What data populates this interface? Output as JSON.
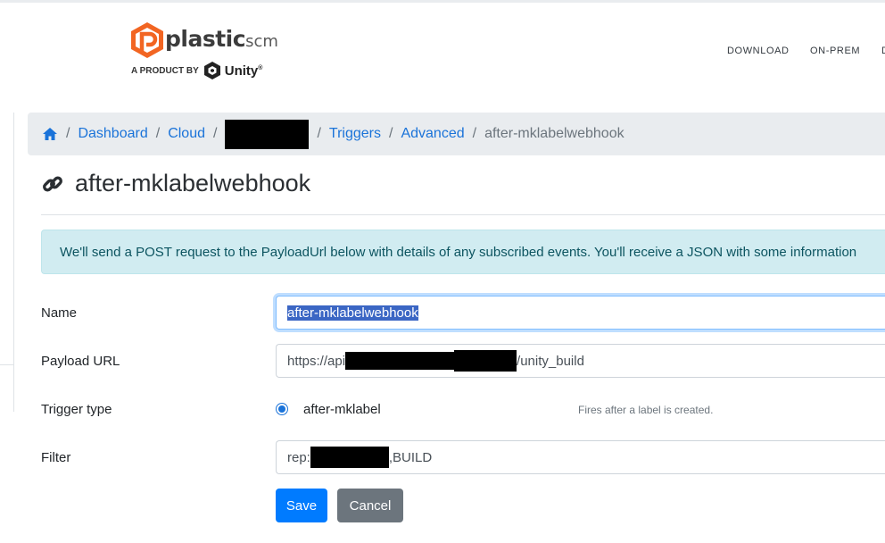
{
  "brand": {
    "word_main": "plastic",
    "word_suffix": "scm",
    "byline": "A PRODUCT BY",
    "unity": "Unity",
    "unity_mark": "®"
  },
  "nav": {
    "download": "DOWNLOAD",
    "onprem": "ON-PREM",
    "cut": "D"
  },
  "breadcrumb": {
    "dashboard": "Dashboard",
    "cloud": "Cloud",
    "triggers": "Triggers",
    "advanced": "Advanced",
    "current": "after-mklabelwebhook",
    "separator": "/"
  },
  "page": {
    "title": "after-mklabelwebhook"
  },
  "alert": {
    "text": "We'll send a POST request to the PayloadUrl below with details of any subscribed events. You'll receive a JSON with some information"
  },
  "form": {
    "name_label": "Name",
    "name_value": "after-mklabelwebhook",
    "payload_label": "Payload URL",
    "payload_prefix": "https://api",
    "payload_suffix": "/unity_build",
    "trigger_label": "Trigger type",
    "trigger_value": "after-mklabel",
    "trigger_help": "Fires after a label is created.",
    "filter_label": "Filter",
    "filter_prefix": "rep:",
    "filter_suffix": ",BUILD"
  },
  "buttons": {
    "save": "Save",
    "cancel": "Cancel"
  },
  "colors": {
    "link": "#1a73d9",
    "primary": "#007bff",
    "secondary": "#6c757d",
    "info_bg": "#d1ecf1",
    "brand_orange": "#f26522"
  }
}
